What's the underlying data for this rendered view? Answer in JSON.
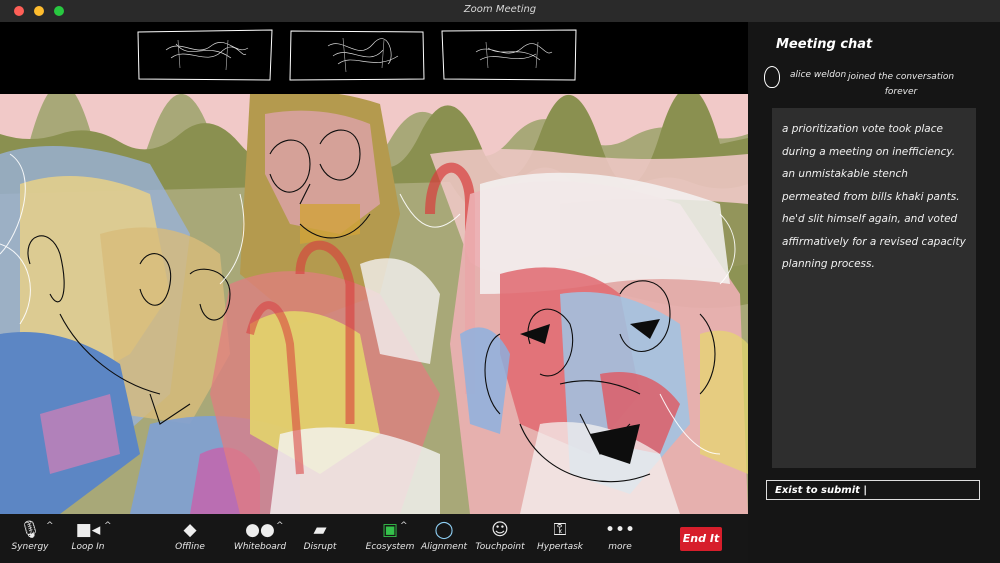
{
  "window": {
    "title": "Zoom Meeting"
  },
  "toolbar": {
    "items": [
      {
        "label": "Synergy",
        "icon": "microphone-icon"
      },
      {
        "label": "Loop In",
        "icon": "video-camera-icon"
      },
      {
        "label": "Offline",
        "icon": "shield-icon"
      },
      {
        "label": "Whiteboard",
        "icon": "participants-icon"
      },
      {
        "label": "Disrupt",
        "icon": "chat-bubble-icon"
      },
      {
        "label": "Ecosystem",
        "icon": "share-screen-icon"
      },
      {
        "label": "Alignment",
        "icon": "record-icon"
      },
      {
        "label": "Touchpoint",
        "icon": "reactions-icon"
      },
      {
        "label": "Hypertask",
        "icon": "apps-icon"
      },
      {
        "label": "more",
        "icon": "more-icon"
      }
    ],
    "end_label": "End It"
  },
  "chat": {
    "title": "Meeting chat",
    "author": "alice weldon",
    "status": "joined the conversation forever",
    "message": "a prioritization vote took place during a meeting on inefficiency. an unmistakable stench permeated from bills khaki pants. he'd slit himself again, and voted affirmatively for a revised capacity planning process.",
    "input_placeholder": "Exist to submit |"
  }
}
